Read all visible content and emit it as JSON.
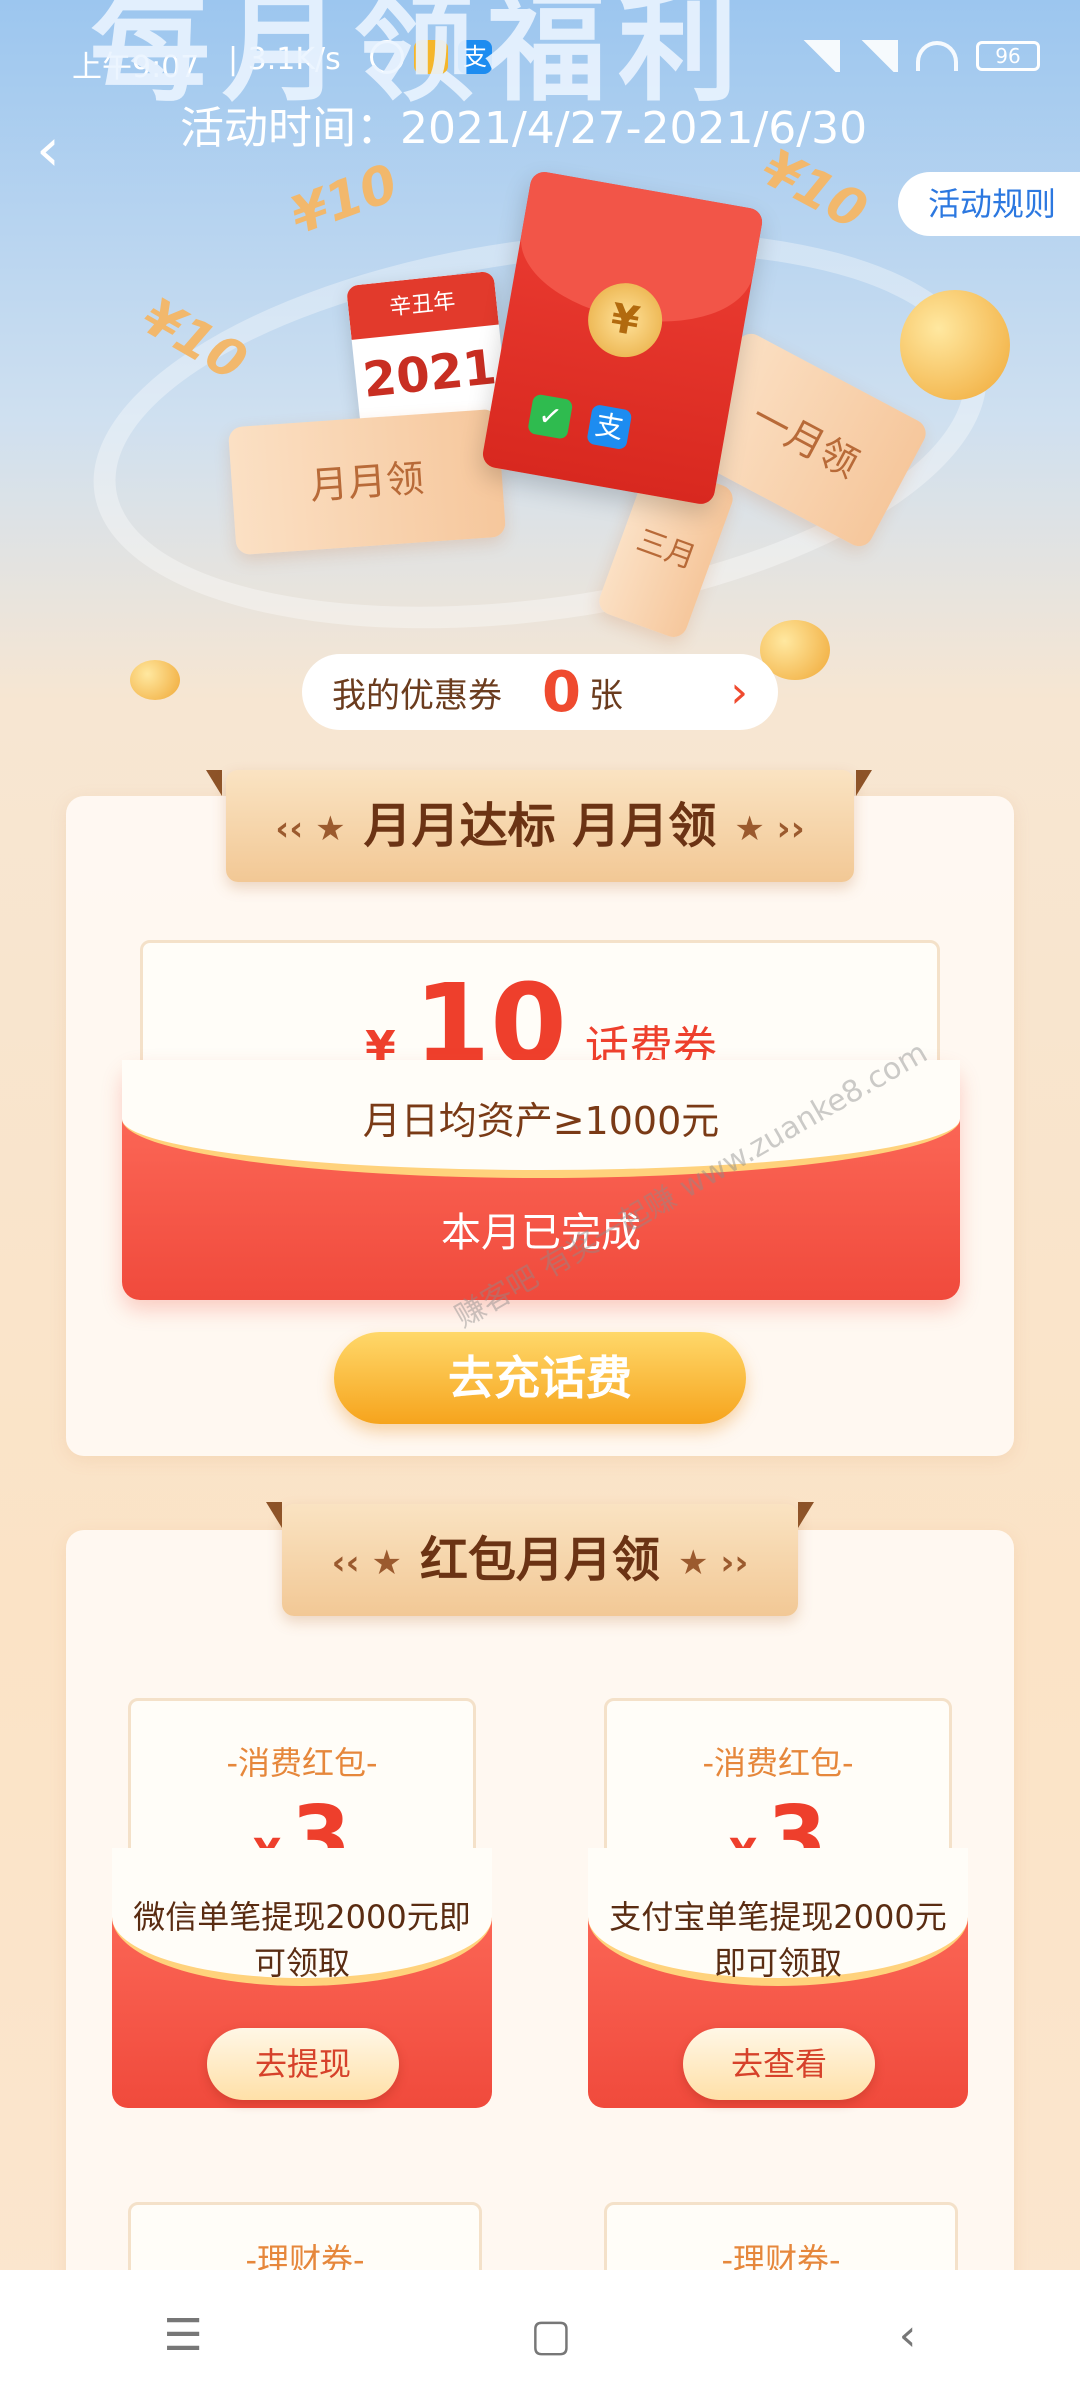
{
  "status_bar": {
    "time": "上午9:07",
    "net_speed": "3.1K/s",
    "battery": "96"
  },
  "banner": {
    "title": "每月领福利",
    "period_label": "活动时间：2021/4/27-2021/6/30",
    "rules_button": "活动规则"
  },
  "illustration": {
    "calendar_top": "辛丑年",
    "calendar_year": "2021",
    "coin_symbol": "¥",
    "ticket_left": "月月领",
    "ticket_right": "一月领",
    "ticket_mid": "三月",
    "coupon_value": "10",
    "wechat_glyph": "✓",
    "alipay_glyph": "支"
  },
  "my_coupon": {
    "label": "我的优惠券",
    "count": "0",
    "unit": "张"
  },
  "section1": {
    "title": "月月达标  月月领",
    "coupon": {
      "currency": "¥",
      "amount": "10",
      "type": "话费券",
      "condition": "月日均资产≥1000元",
      "status": "本月已完成"
    },
    "action_button": "去充话费"
  },
  "section2": {
    "title": "红包月月领",
    "cards": [
      {
        "kind": "-消费红包-",
        "currency": "¥",
        "amount": "3",
        "desc": "微信单笔提现2000元即可领取",
        "button": "去提现"
      },
      {
        "kind": "-消费红包-",
        "currency": "¥",
        "amount": "3",
        "desc": "支付宝单笔提现2000元即可领取",
        "button": "去查看"
      }
    ],
    "next_row_kinds": [
      "-理财券-",
      "-理财券-"
    ]
  },
  "watermark": "赚客吧 有奖一起赚 www.zuanke8.com",
  "nav": {
    "menu_glyph": "☰",
    "home_glyph": "▢",
    "back_glyph": "‹"
  },
  "colors": {
    "accent_red": "#ef4a2f",
    "gold": "#f6a41d",
    "brown_text": "#6b3314",
    "rules_blue": "#2c78e0"
  }
}
